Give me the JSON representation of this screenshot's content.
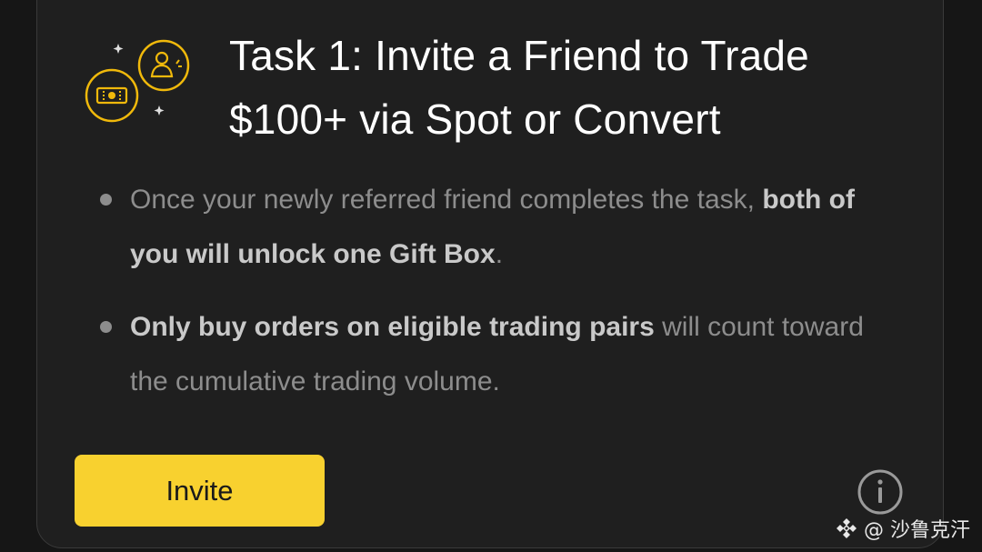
{
  "task": {
    "title": "Task 1: Invite a Friend to Trade $100+ via Spot or Convert",
    "icon": "ticket-and-user-icon",
    "bullets": [
      {
        "text_before": "Once your newly referred friend completes the task, ",
        "bold": "both of you will unlock one Gift Box",
        "text_after": "."
      },
      {
        "text_before": "",
        "bold": "Only buy orders on eligible trading pairs",
        "text_after": " will count toward the cumulative trading volume."
      }
    ]
  },
  "actions": {
    "invite_label": "Invite",
    "info_icon": "info-icon"
  },
  "watermark": {
    "text": "@ 沙鲁克汗",
    "icon": "diamond-logo-icon"
  },
  "colors": {
    "background": "#161616",
    "card": "#1f1f1f",
    "accent": "#f8d12f",
    "title_text": "#ffffff",
    "body_text": "#8d8d8d",
    "bold_text": "#c9c9c9"
  }
}
